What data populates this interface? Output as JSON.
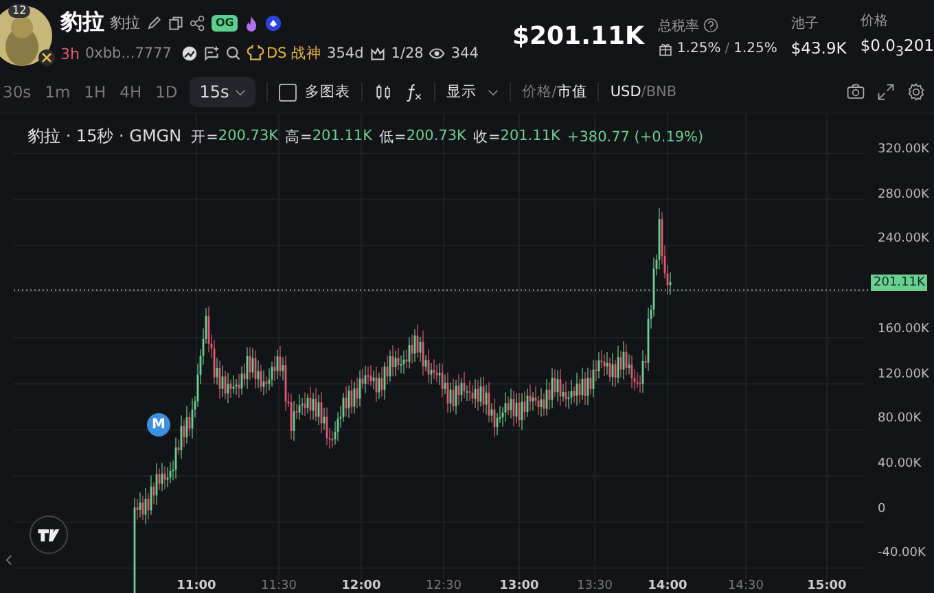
{
  "token": {
    "avatar_level": "12",
    "name": "豹拉",
    "alias": "豹拉",
    "badge": "OG",
    "age": "3h",
    "address": "0xbb...7777",
    "rank_label": "DS 战神",
    "rank_days": "354d",
    "holders": "1/28",
    "views": "344"
  },
  "stats": {
    "market_cap": "$201.11K",
    "tax": {
      "label": "总税率",
      "buy": "1.25%",
      "separator": "/",
      "sell": "1.25%"
    },
    "pool": {
      "label": "池子",
      "value": "$43.9K"
    },
    "price": {
      "label": "价格",
      "value": "$0.0$_{3}$201"
    }
  },
  "toolbar": {
    "intervals": [
      {
        "label": "30s",
        "selected": false
      },
      {
        "label": "1m",
        "selected": false
      },
      {
        "label": "1H",
        "selected": false
      },
      {
        "label": "4H",
        "selected": false
      },
      {
        "label": "1D",
        "selected": false
      }
    ],
    "current_interval": {
      "label": "15s",
      "selected": true
    },
    "multi_chart": {
      "label": "多图表",
      "checked": false
    },
    "display": "显示",
    "separator": "/",
    "price_modes": [
      {
        "label": "价格",
        "selected": false
      },
      {
        "label": "市值",
        "selected": true
      }
    ],
    "currencies": [
      {
        "label": "USD",
        "selected": true
      },
      {
        "label": "BNB",
        "selected": false
      }
    ]
  },
  "legend": {
    "title": "豹拉 · 15秒 · GMGN",
    "items": [
      {
        "label": "开=",
        "value": "200.73K"
      },
      {
        "label": "高=",
        "value": "201.11K"
      },
      {
        "label": "低=",
        "value": "200.73K"
      },
      {
        "label": "收=",
        "value": "201.11K"
      }
    ],
    "change": "+380.77 (+0.19%)"
  },
  "y_axis": [
    "320.00K",
    "280.00K",
    "240.00K",
    "160.00K",
    "120.00K",
    "80.00K",
    "40.00K",
    "0",
    "-40.00K"
  ],
  "last_price": "201.11K",
  "marker": "M",
  "x_axis": [
    "11:00",
    "11:30",
    "12:00",
    "12:30",
    "13:00",
    "13:30",
    "14:00",
    "14:30",
    "15:00"
  ]
}
